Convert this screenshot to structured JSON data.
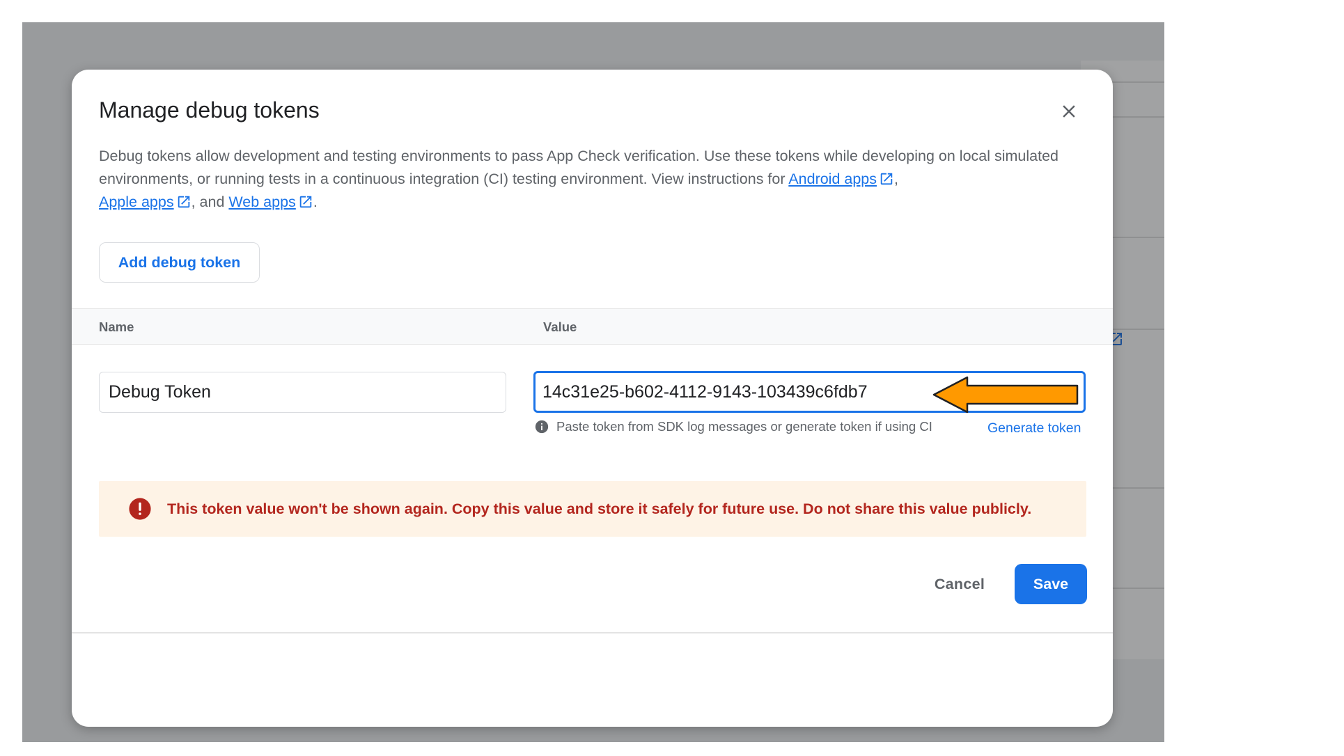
{
  "dialog": {
    "title": "Manage debug tokens",
    "description_text": "Debug tokens allow development and testing environments to pass App Check verification. Use these tokens while developing on local simulated environments, or running tests in a continuous integration (CI) testing environment. View instructions for ",
    "links": {
      "android": "Android apps",
      "apple": "Apple apps",
      "web": "Web apps"
    },
    "sep_comma": ",",
    "sep_and": ", and ",
    "end_period": ".",
    "add_button": "Add debug token",
    "columns": {
      "name": "Name",
      "value": "Value"
    },
    "name_value": "Debug Token",
    "token_value": "14c31e25-b602-4112-9143-103439c6fdb7",
    "hint": "Paste token from SDK log messages or generate token if using CI",
    "generate_link": "Generate token",
    "warning": "This token value won't be shown again. Copy this value and store it safely for future use. Do not share this value publicly.",
    "cancel": "Cancel",
    "save": "Save"
  },
  "icons": {
    "close": "close-icon",
    "external_link": "open-in-new-icon",
    "info": "info-icon",
    "error": "error-icon",
    "annotation_arrow": "arrow-left-annotation"
  },
  "colors": {
    "accent": "#1a73e8",
    "warning_bg": "#fef3e6",
    "warning_text": "#b3261e",
    "annotation_arrow": "#ff9900"
  }
}
